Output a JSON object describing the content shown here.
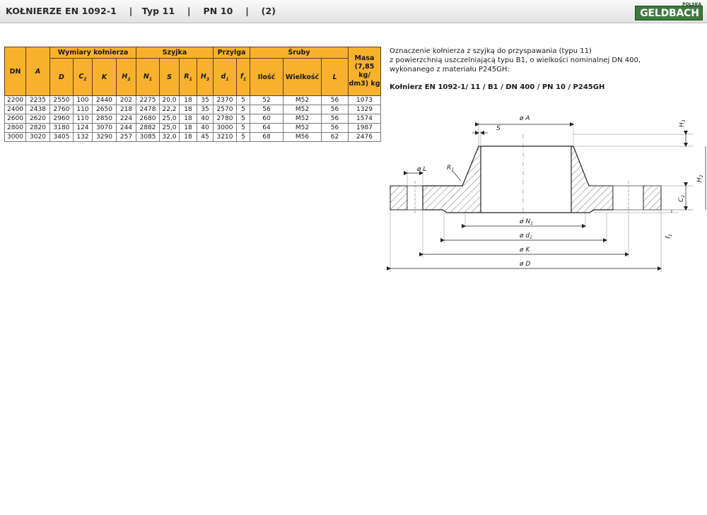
{
  "header": {
    "title": "KOŁNIERZE EN 1092-1    |   Typ 11    |    PN 10    |    (2)",
    "logo_text": "GELDBACH",
    "logo_sub": "POLSKA"
  },
  "table": {
    "group_headers": {
      "dn": "DN",
      "wymiary": "Wymiary kołnierza",
      "szyjka": "Szyjka",
      "przylga": "Przylga",
      "sruby": "Śruby",
      "masa": "Masa (7,85 kg/ dm3) kg"
    },
    "sub_headers": [
      {
        "main": "A",
        "sub": ""
      },
      {
        "main": "D",
        "sub": ""
      },
      {
        "main": "C",
        "sub": "2"
      },
      {
        "main": "K",
        "sub": ""
      },
      {
        "main": "H",
        "sub": "2"
      },
      {
        "main": "N",
        "sub": "1"
      },
      {
        "main": "S",
        "sub": ""
      },
      {
        "main": "R",
        "sub": "1"
      },
      {
        "main": "H",
        "sub": "3"
      },
      {
        "main": "d",
        "sub": "1"
      },
      {
        "main": "f",
        "sub": "1"
      },
      {
        "main": "Ilość",
        "sub": ""
      },
      {
        "main": "Wielkość",
        "sub": ""
      },
      {
        "main": "L",
        "sub": ""
      }
    ],
    "rows": [
      [
        "2200",
        "2235",
        "2550",
        "100",
        "2440",
        "202",
        "2275",
        "20,0",
        "18",
        "35",
        "2370",
        "5",
        "52",
        "M52",
        "56",
        "1073"
      ],
      [
        "2400",
        "2438",
        "2760",
        "110",
        "2650",
        "218",
        "2478",
        "22,2",
        "18",
        "35",
        "2570",
        "5",
        "56",
        "M52",
        "56",
        "1329"
      ],
      [
        "2600",
        "2620",
        "2960",
        "110",
        "2850",
        "224",
        "2680",
        "25,0",
        "18",
        "40",
        "2780",
        "5",
        "60",
        "M52",
        "56",
        "1574"
      ],
      [
        "2800",
        "2820",
        "3180",
        "124",
        "3070",
        "244",
        "2882",
        "25,0",
        "18",
        "40",
        "3000",
        "5",
        "64",
        "M52",
        "56",
        "1987"
      ],
      [
        "3000",
        "3020",
        "3405",
        "132",
        "3290",
        "257",
        "3085",
        "32,0",
        "18",
        "45",
        "3210",
        "5",
        "68",
        "M56",
        "62",
        "2476"
      ]
    ]
  },
  "description": {
    "lines": [
      "Oznaczenie kołnierza z szyjką do przyspawania (typu 11)",
      "z powierzchnią uszczelniającą typu B1, o wielkości nominalnej DN 400,",
      "wykonanego z materiału P245GH:"
    ],
    "code": "Kołnierz EN 1092-1/ 11 / B1 / DN 400 / PN 10 / P245GH"
  },
  "drawing": {
    "labels": {
      "A": "ø A",
      "S": "S",
      "H3": "H",
      "H3_sub": "3",
      "H2": "H",
      "H2_sub": "2",
      "C2": "C",
      "C2_sub": "2",
      "L": "ø L",
      "R1": "R",
      "R1_sub": "1",
      "N1": "ø N",
      "N1_sub": "1",
      "d1": "ø d",
      "d1_sub": "1",
      "K": "ø K",
      "D": "ø D",
      "f1": "f",
      "f1_sub": "1"
    }
  }
}
